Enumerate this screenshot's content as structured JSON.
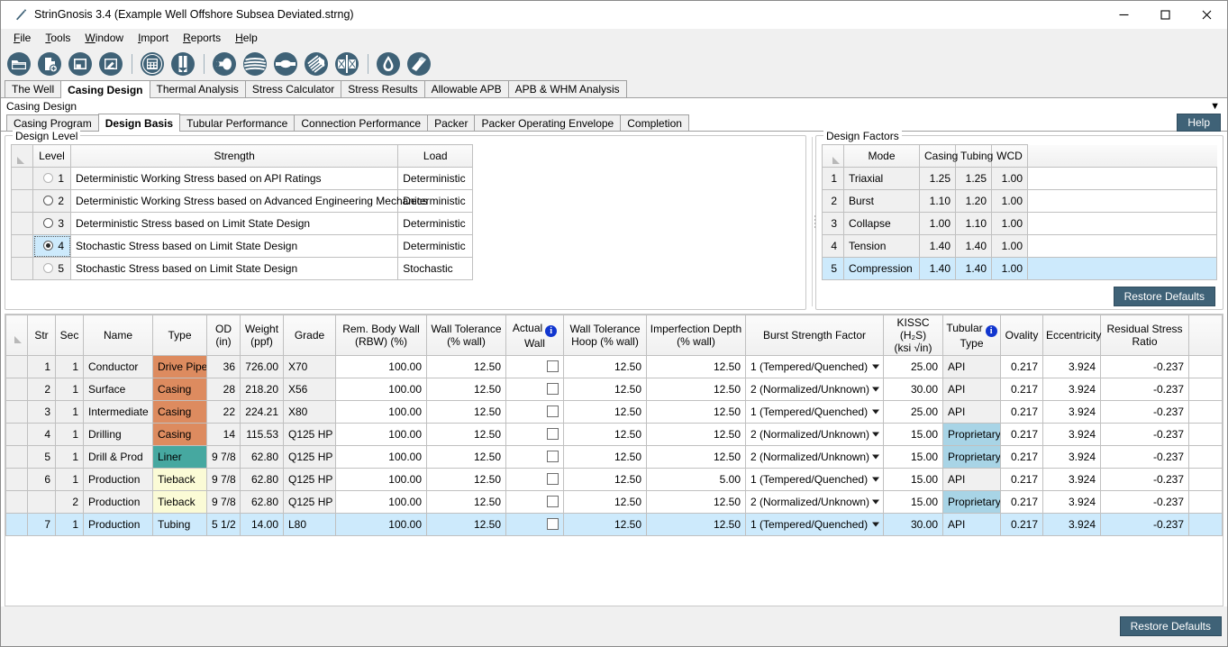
{
  "window": {
    "title": "StrinGnosis 3.4 (Example Well Offshore Subsea Deviated.strng)",
    "minimize_label": "minimize-icon",
    "maximize_label": "maximize-icon",
    "close_label": "close-icon"
  },
  "menu": [
    {
      "label": "File",
      "mnemonic": "F"
    },
    {
      "label": "Tools",
      "mnemonic": "T"
    },
    {
      "label": "Window",
      "mnemonic": "W"
    },
    {
      "label": "Import",
      "mnemonic": "I"
    },
    {
      "label": "Reports",
      "mnemonic": "R"
    },
    {
      "label": "Help",
      "mnemonic": "H"
    }
  ],
  "toolbar": {
    "icons": [
      "open-folder-icon",
      "new-document-icon",
      "save-icon",
      "edit-document-icon",
      "separator",
      "calculator-icon",
      "tubular-icon",
      "separator",
      "pipe-burst-icon",
      "pipe-collapse-icon",
      "pipe-tension-icon",
      "connection-thread-icon",
      "packer-icon",
      "separator",
      "fluid-drop-icon",
      "cement-icon"
    ]
  },
  "main_tabs": {
    "active": "Casing Design",
    "items": [
      "The Well",
      "Casing Design",
      "Thermal Analysis",
      "Stress Calculator",
      "Stress Results",
      "Allowable APB",
      "APB & WHM Analysis"
    ]
  },
  "page": {
    "caption": "Casing Design",
    "collapse_icon": "chevron-down-icon"
  },
  "sub_tabs": {
    "active": "Design Basis",
    "items": [
      "Casing Program",
      "Design Basis",
      "Tubular Performance",
      "Connection Performance",
      "Packer",
      "Packer Operating Envelope",
      "Completion"
    ],
    "help_label": "Help"
  },
  "design_level": {
    "title": "Design Level",
    "columns": [
      "Level",
      "Strength",
      "Load"
    ],
    "selected_level": 4,
    "rows": [
      {
        "level": "1",
        "strength": "Deterministic Working Stress based on API Ratings",
        "load": "Deterministic",
        "enabled": false
      },
      {
        "level": "2",
        "strength": "Deterministic Working Stress based on Advanced Engineering Mechanics",
        "load": "Deterministic",
        "enabled": true
      },
      {
        "level": "3",
        "strength": "Deterministic Stress based on Limit State Design",
        "load": "Deterministic",
        "enabled": true
      },
      {
        "level": "4",
        "strength": "Stochastic Stress based on Limit State Design",
        "load": "Deterministic",
        "enabled": true
      },
      {
        "level": "5",
        "strength": "Stochastic Stress based on Limit State Design",
        "load": "Stochastic",
        "enabled": false
      }
    ]
  },
  "design_factors": {
    "title": "Design Factors",
    "columns": [
      "Mode",
      "Casing",
      "Tubing",
      "WCD"
    ],
    "selected_row": 5,
    "rows": [
      {
        "idx": "1",
        "mode": "Triaxial",
        "casing": "1.25",
        "tubing": "1.25",
        "wcd": "1.00"
      },
      {
        "idx": "2",
        "mode": "Burst",
        "casing": "1.10",
        "tubing": "1.20",
        "wcd": "1.00"
      },
      {
        "idx": "3",
        "mode": "Collapse",
        "casing": "1.00",
        "tubing": "1.10",
        "wcd": "1.00"
      },
      {
        "idx": "4",
        "mode": "Tension",
        "casing": "1.40",
        "tubing": "1.40",
        "wcd": "1.00"
      },
      {
        "idx": "5",
        "mode": "Compression",
        "casing": "1.40",
        "tubing": "1.40",
        "wcd": "1.00"
      }
    ],
    "restore_label": "Restore Defaults"
  },
  "tubular_table": {
    "columns": [
      {
        "l1": "Str",
        "l2": ""
      },
      {
        "l1": "Sec",
        "l2": ""
      },
      {
        "l1": "Name",
        "l2": ""
      },
      {
        "l1": "Type",
        "l2": ""
      },
      {
        "l1": "OD",
        "l2": "(in)"
      },
      {
        "l1": "Weight",
        "l2": "(ppf)"
      },
      {
        "l1": "Grade",
        "l2": ""
      },
      {
        "l1": "Rem. Body Wall",
        "l2": "(RBW) (%)"
      },
      {
        "l1": "Wall Tolerance",
        "l2": "(% wall)"
      },
      {
        "l1": "Actual",
        "l2": "Wall",
        "info": true
      },
      {
        "l1": "Wall Tolerance",
        "l2": "Hoop (% wall)"
      },
      {
        "l1": "Imperfection Depth",
        "l2": "(% wall)"
      },
      {
        "l1": "Burst Strength Factor",
        "l2": ""
      },
      {
        "l1": "KISSC (H₂S)",
        "l2": "(ksi √in)"
      },
      {
        "l1": "Tubular",
        "l2": "Type",
        "info": true
      },
      {
        "l1": "Ovality",
        "l2": ""
      },
      {
        "l1": "Eccentricity",
        "l2": ""
      },
      {
        "l1": "Residual Stress",
        "l2": "Ratio"
      }
    ],
    "selected_row_index": 7,
    "rows": [
      {
        "str": "1",
        "sec": "1",
        "name": "Conductor",
        "type": "Drive Pipe",
        "type_class": "casing",
        "od": "36",
        "weight": "726.00",
        "grade": "X70",
        "rbw": "100.00",
        "wall_tol": "12.50",
        "actual_wall": false,
        "wall_tol_hoop": "12.50",
        "imperfection": "12.50",
        "burst": "1 (Tempered/Quenched)",
        "kissc": "25.00",
        "tubular_type": "API",
        "tt_class": "api",
        "ovality": "0.217",
        "ecc": "3.924",
        "rsr": "-0.237"
      },
      {
        "str": "2",
        "sec": "1",
        "name": "Surface",
        "type": "Casing",
        "type_class": "casing",
        "od": "28",
        "weight": "218.20",
        "grade": "X56",
        "rbw": "100.00",
        "wall_tol": "12.50",
        "actual_wall": false,
        "wall_tol_hoop": "12.50",
        "imperfection": "12.50",
        "burst": "2 (Normalized/Unknown)",
        "kissc": "30.00",
        "tubular_type": "API",
        "tt_class": "api",
        "ovality": "0.217",
        "ecc": "3.924",
        "rsr": "-0.237"
      },
      {
        "str": "3",
        "sec": "1",
        "name": "Intermediate",
        "type": "Casing",
        "type_class": "casing",
        "od": "22",
        "weight": "224.21",
        "grade": "X80",
        "rbw": "100.00",
        "wall_tol": "12.50",
        "actual_wall": false,
        "wall_tol_hoop": "12.50",
        "imperfection": "12.50",
        "burst": "1 (Tempered/Quenched)",
        "kissc": "25.00",
        "tubular_type": "API",
        "tt_class": "api",
        "ovality": "0.217",
        "ecc": "3.924",
        "rsr": "-0.237"
      },
      {
        "str": "4",
        "sec": "1",
        "name": "Drilling",
        "type": "Casing",
        "type_class": "casing",
        "od": "14",
        "weight": "115.53",
        "grade": "Q125 HP",
        "rbw": "100.00",
        "wall_tol": "12.50",
        "actual_wall": false,
        "wall_tol_hoop": "12.50",
        "imperfection": "12.50",
        "burst": "2 (Normalized/Unknown)",
        "kissc": "15.00",
        "tubular_type": "Proprietary",
        "tt_class": "prop",
        "ovality": "0.217",
        "ecc": "3.924",
        "rsr": "-0.237"
      },
      {
        "str": "5",
        "sec": "1",
        "name": "Drill & Prod",
        "type": "Liner",
        "type_class": "liner",
        "od": "9 7/8",
        "weight": "62.80",
        "grade": "Q125 HP",
        "rbw": "100.00",
        "wall_tol": "12.50",
        "actual_wall": false,
        "wall_tol_hoop": "12.50",
        "imperfection": "12.50",
        "burst": "2 (Normalized/Unknown)",
        "kissc": "15.00",
        "tubular_type": "Proprietary",
        "tt_class": "prop",
        "ovality": "0.217",
        "ecc": "3.924",
        "rsr": "-0.237"
      },
      {
        "str": "6",
        "sec": "1",
        "name": "Production",
        "type": "Tieback",
        "type_class": "tieback",
        "od": "9 7/8",
        "weight": "62.80",
        "grade": "Q125 HP",
        "rbw": "100.00",
        "wall_tol": "12.50",
        "actual_wall": false,
        "wall_tol_hoop": "12.50",
        "imperfection": "5.00",
        "burst": "1 (Tempered/Quenched)",
        "kissc": "15.00",
        "tubular_type": "API",
        "tt_class": "api",
        "ovality": "0.217",
        "ecc": "3.924",
        "rsr": "-0.237"
      },
      {
        "str": "",
        "sec": "2",
        "name": "Production",
        "type": "Tieback",
        "type_class": "tieback",
        "od": "9 7/8",
        "weight": "62.80",
        "grade": "Q125 HP",
        "rbw": "100.00",
        "wall_tol": "12.50",
        "actual_wall": false,
        "wall_tol_hoop": "12.50",
        "imperfection": "12.50",
        "burst": "2 (Normalized/Unknown)",
        "kissc": "15.00",
        "tubular_type": "Proprietary",
        "tt_class": "prop",
        "ovality": "0.217",
        "ecc": "3.924",
        "rsr": "-0.237"
      },
      {
        "str": "7",
        "sec": "1",
        "name": "Production",
        "type": "Tubing",
        "type_class": "none",
        "od": "5 1/2",
        "weight": "14.00",
        "grade": "L80",
        "rbw": "100.00",
        "wall_tol": "12.50",
        "actual_wall": false,
        "wall_tol_hoop": "12.50",
        "imperfection": "12.50",
        "burst": "1 (Tempered/Quenched)",
        "kissc": "30.00",
        "tubular_type": "API",
        "tt_class": "api",
        "ovality": "0.217",
        "ecc": "3.924",
        "rsr": "-0.237"
      }
    ],
    "restore_label": "Restore Defaults"
  },
  "colors": {
    "accent_button": "#3f6277",
    "selection": "#cdeafc",
    "type_casing": "#dd8b5f",
    "type_liner": "#46a8a0",
    "type_tieback": "#fbfbd6",
    "tubular_proprietary": "#a8d4e6",
    "info_icon": "#1136cf",
    "toolbar_icon": "#3f6277"
  }
}
